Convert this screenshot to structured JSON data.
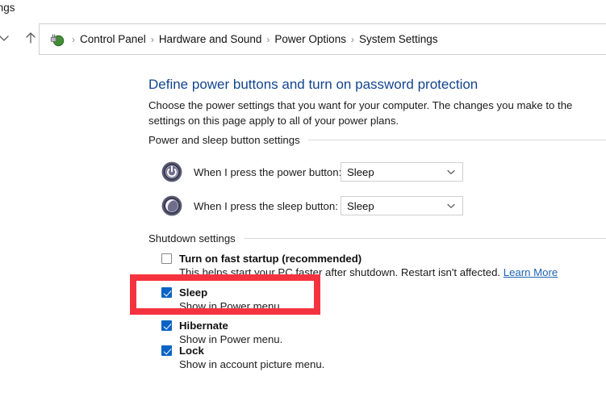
{
  "window": {
    "title_fragment": "tings"
  },
  "navigation": {
    "back_icon": "chevron-down-icon",
    "up_icon": "up-arrow-icon",
    "address_icon": "power-plug-icon",
    "separator": "›",
    "breadcrumbs": [
      "Control Panel",
      "Hardware and Sound",
      "Power Options",
      "System Settings"
    ]
  },
  "page": {
    "title": "Define power buttons and turn on password protection",
    "description": "Choose the power settings that you want for your computer. The changes you make to the settings on this page apply to all of your power plans."
  },
  "sections": {
    "power_buttons": {
      "label": "Power and sleep button settings",
      "rows": [
        {
          "icon": "power-button-icon",
          "label": "When I press the power button:",
          "value": "Sleep",
          "arrow_icon": "chevron-down-icon"
        },
        {
          "icon": "sleep-moon-icon",
          "label": "When I press the sleep button:",
          "value": "Sleep",
          "arrow_icon": "chevron-down-icon"
        }
      ]
    },
    "shutdown": {
      "label": "Shutdown settings",
      "items": [
        {
          "title": "Turn on fast startup (recommended)",
          "checked": false,
          "sub_prefix": "This helps start your PC faster after shutdown. Restart isn't affected. ",
          "link": "Learn More"
        },
        {
          "title": "Sleep",
          "checked": true,
          "sub_prefix": "Show in Power menu.",
          "link": ""
        },
        {
          "title": "Hibernate",
          "checked": true,
          "sub_prefix": "Show in Power menu.",
          "link": ""
        },
        {
          "title": "Lock",
          "checked": true,
          "sub_prefix": "Show in account picture menu.",
          "link": ""
        }
      ]
    }
  },
  "annotation": {
    "shape": "rectangle",
    "color": "#f5333f",
    "target": "Sleep"
  }
}
